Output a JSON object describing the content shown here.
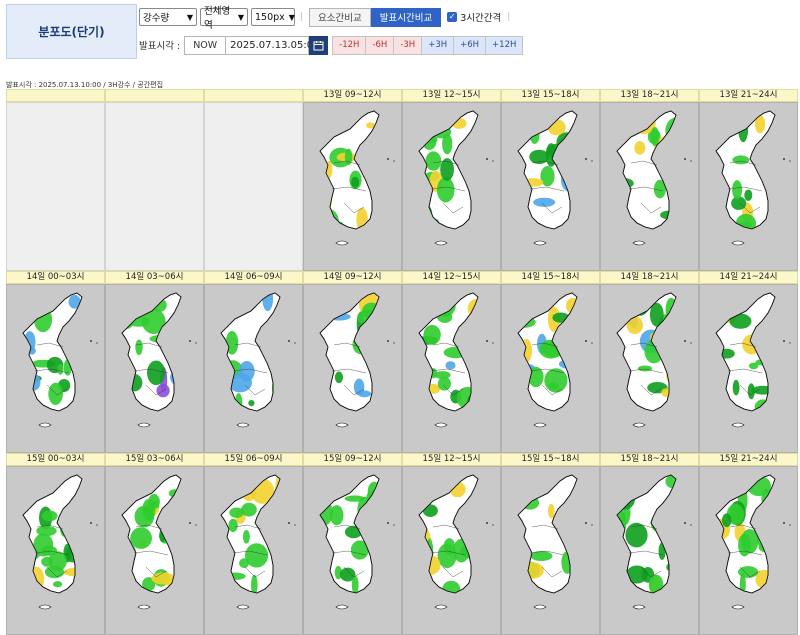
{
  "header": {
    "title": "분포도(단기)",
    "selects": [
      {
        "name": "variable-select",
        "value": "강수량"
      },
      {
        "name": "region-select",
        "value": "전체영역"
      },
      {
        "name": "size-select",
        "value": "150px"
      }
    ],
    "compare_tabs": [
      {
        "label": "요소간비교",
        "active": false
      },
      {
        "label": "발표시간비교",
        "active": true
      }
    ],
    "checkbox_label": "3시간간격",
    "checkbox_checked": true,
    "issue_label": "발표시각 :",
    "now_label": "NOW",
    "issue_time": "2025.07.13.05:00",
    "steps_minus": [
      "-12H",
      "-6H",
      "-3H"
    ],
    "steps_plus": [
      "+3H",
      "+6H",
      "+12H"
    ]
  },
  "caption": "발표시각 : 2025.07.13.10:00 / 3H강수 / 공간편집",
  "rows": [
    {
      "headers": [
        "",
        "",
        "",
        "13일 09~12시",
        "13일 12~15시",
        "13일 15~18시",
        "13일 18~21시",
        "13일 21~24시"
      ]
    },
    {
      "headers": [
        "14일 00~03시",
        "14일 03~06시",
        "14일 06~09시",
        "14일 09~12시",
        "14일 12~15시",
        "14일 15~18시",
        "14일 18~21시",
        "14일 21~24시"
      ]
    },
    {
      "headers": [
        "15일 00~03시",
        "15일 03~06시",
        "15일 06~09시",
        "15일 09~12시",
        "15일 12~15시",
        "15일 15~18시",
        "15일 18~21시",
        "15일 21~24시"
      ]
    }
  ],
  "colors": {
    "accent": "#2f63c5",
    "map_bg": "#c9c9c9",
    "land": "#ffffff",
    "green": "#2fcc2f",
    "dark_green": "#0e9e1e",
    "yellow": "#f2d22e",
    "blue": "#4ea6e8",
    "purple": "#8a4fd8"
  }
}
